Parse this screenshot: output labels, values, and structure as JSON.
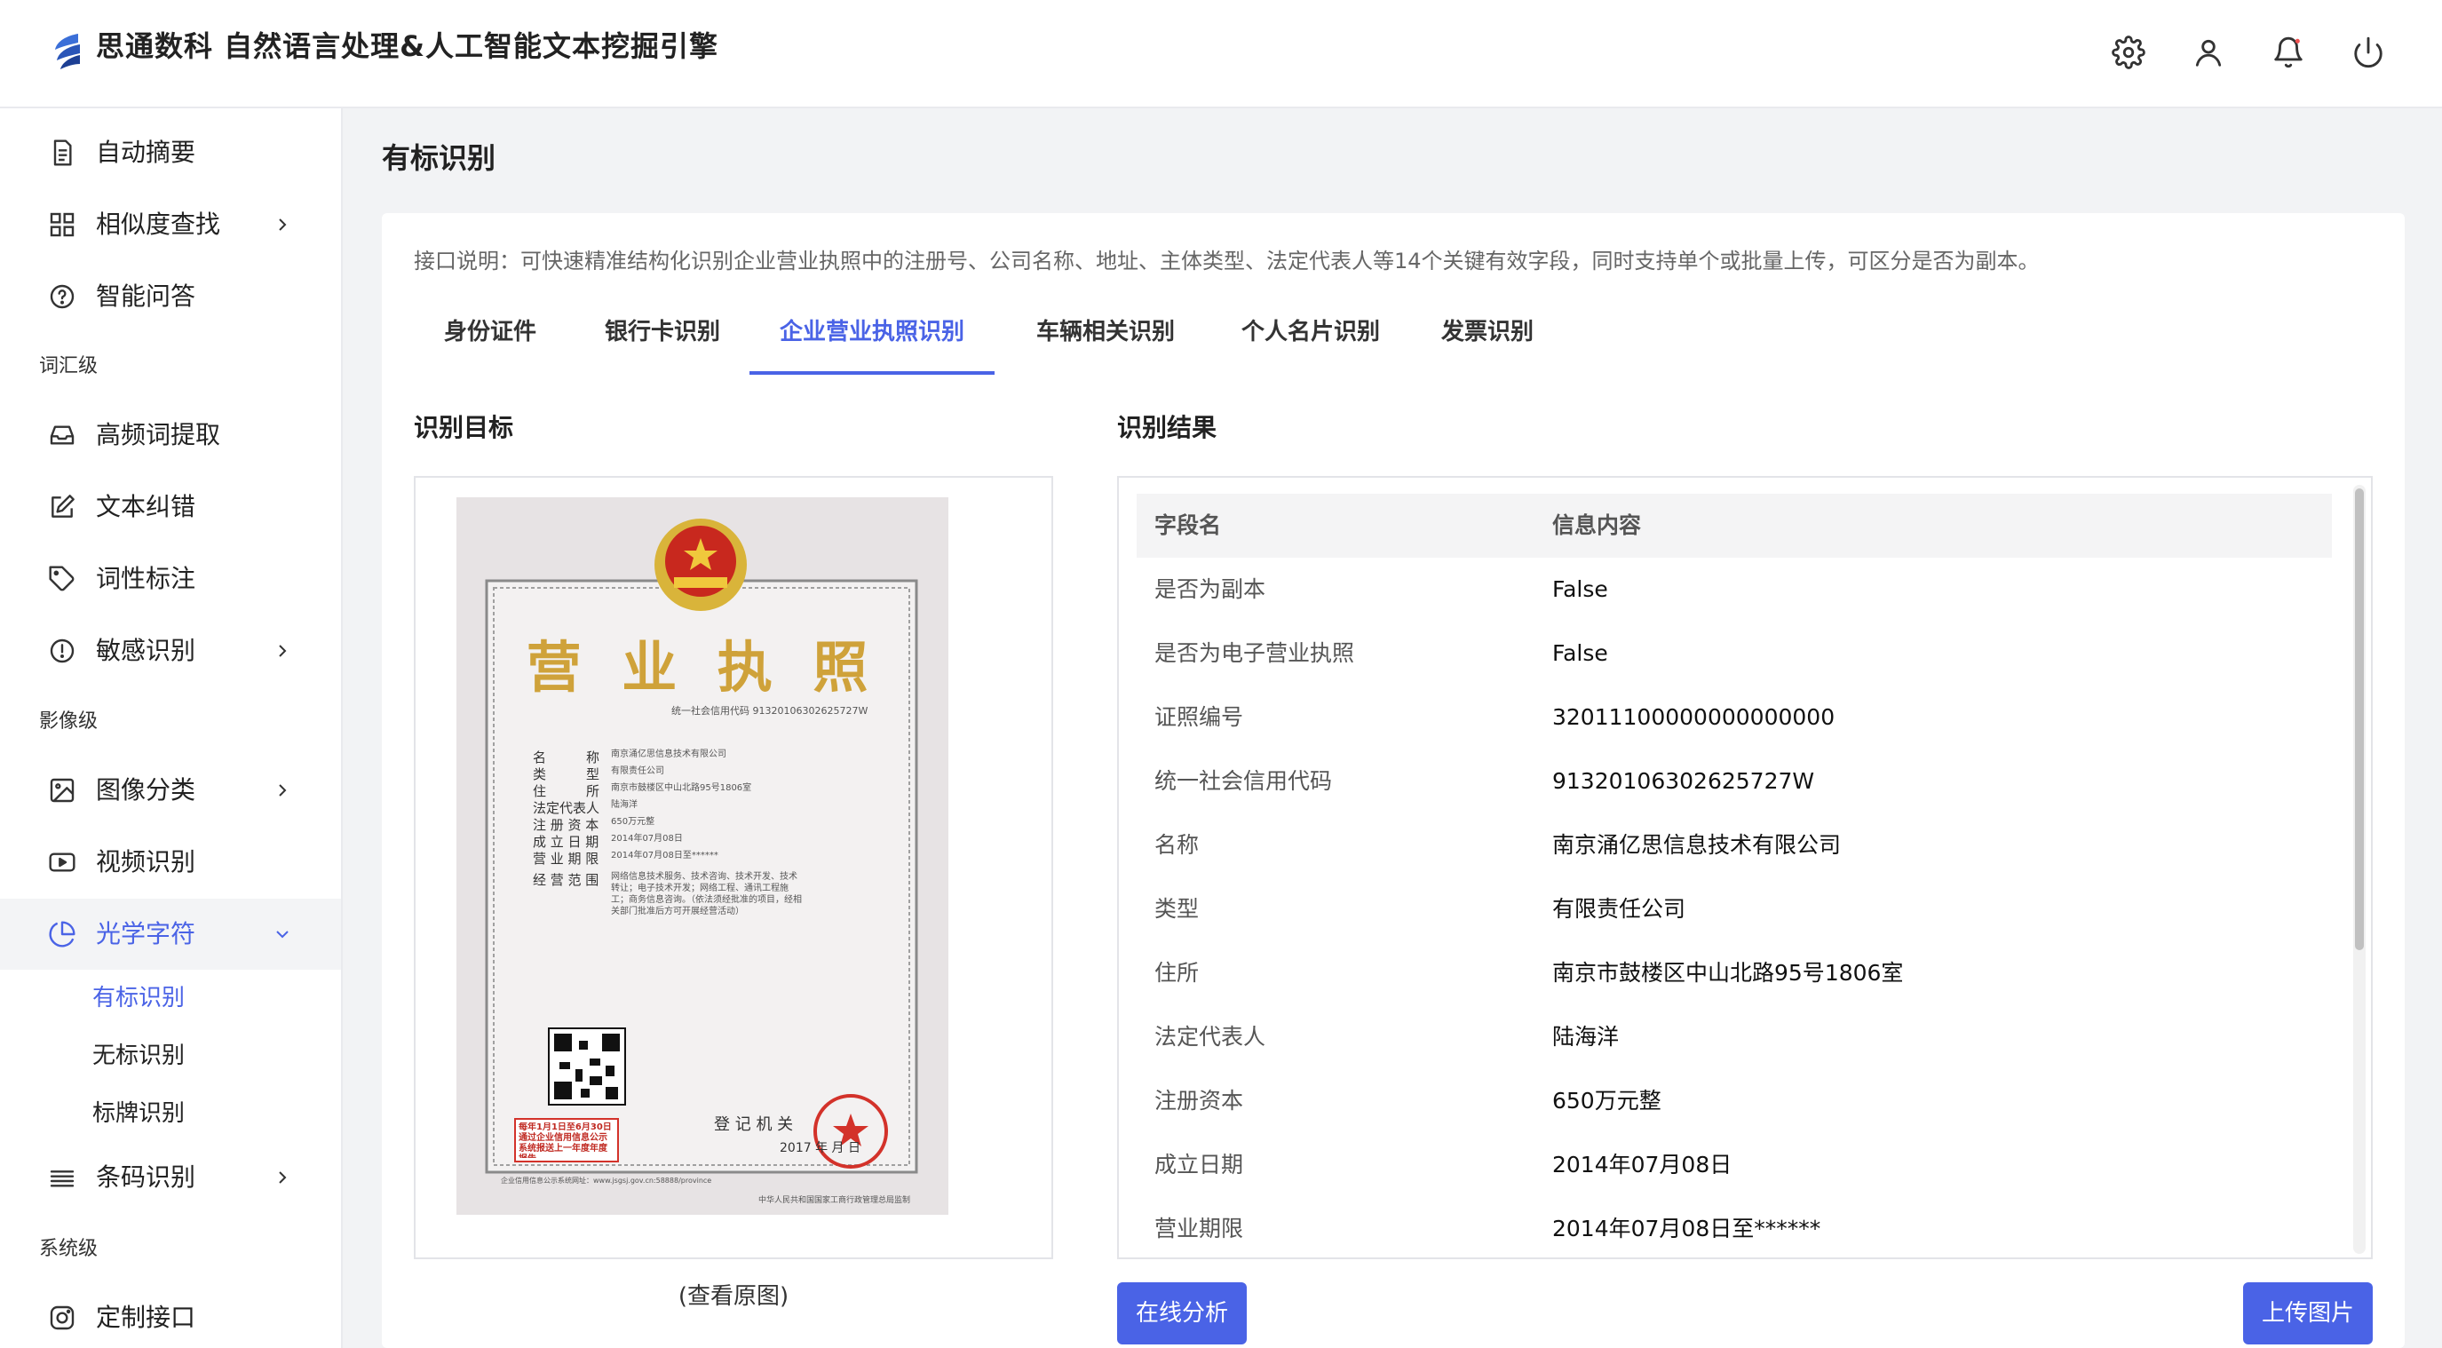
{
  "header": {
    "title": "思通数科 自然语言处理&人工智能文本挖掘引擎",
    "icons": [
      "gear-icon",
      "user-icon",
      "bell-icon",
      "power-icon"
    ]
  },
  "sidebar": {
    "items": [
      {
        "label": "自动摘要",
        "icon": "document-icon"
      },
      {
        "label": "相似度查找",
        "icon": "grid-icon"
      },
      {
        "label": "智能问答",
        "icon": "question-circle-icon"
      },
      {
        "label": "高频词提取",
        "icon": "inbox-icon"
      },
      {
        "label": "文本纠错",
        "icon": "edit-icon"
      },
      {
        "label": "词性标注",
        "icon": "tag-icon"
      },
      {
        "label": "敏感识别",
        "icon": "alert-circle-icon"
      },
      {
        "label": "图像分类",
        "icon": "image-icon"
      },
      {
        "label": "视频识别",
        "icon": "video-icon"
      },
      {
        "label": "光学字符",
        "icon": "pie-chart-icon"
      },
      {
        "label": "条码识别",
        "icon": "menu-lines-icon"
      },
      {
        "label": "定制接口",
        "icon": "instagram-icon"
      }
    ],
    "groups": [
      "词汇级",
      "影像级",
      "系统级"
    ],
    "sub_items": [
      "有标识别",
      "无标识别",
      "标牌识别"
    ]
  },
  "main": {
    "page_title": "有标识别",
    "description": "接口说明：可快速精准结构化识别企业营业执照中的注册号、公司名称、地址、主体类型、法定代表人等14个关键有效字段，同时支持单个或批量上传，可区分是否为副本。",
    "tabs": [
      "身份证件",
      "银行卡识别",
      "企业营业执照识别",
      "车辆相关识别",
      "个人名片识别",
      "发票识别"
    ],
    "active_tab": "企业营业执照识别",
    "target_title": "识别目标",
    "result_title": "识别结果",
    "view_original": "(查看原图)",
    "analyze_button": "在线分析",
    "upload_button": "上传图片"
  },
  "license_image": {
    "heading": "营 业 执 照",
    "credit_line": "统一社会信用代码 91320106302625727W",
    "fields": [
      {
        "k": "名　　　称",
        "v": "南京涌亿思信息技术有限公司"
      },
      {
        "k": "类　　　型",
        "v": "有限责任公司"
      },
      {
        "k": "住　　　所",
        "v": "南京市鼓楼区中山北路95号1806室"
      },
      {
        "k": "法定代表人",
        "v": "陆海洋"
      },
      {
        "k": "注 册 资 本",
        "v": "650万元整"
      },
      {
        "k": "成 立 日 期",
        "v": "2014年07月08日"
      },
      {
        "k": "营 业 期 限",
        "v": "2014年07月08日至******"
      },
      {
        "k": "经 营 范 围",
        "v": "网络信息技术服务、技术咨询、技术开发、技术转让；电子技术开发；网络工程、通讯工程施工；商务信息咨询。（依法须经批准的项目，经相关部门批准后方可开展经营活动）"
      }
    ],
    "registrar": "登 记 机 关",
    "date": "2017 年 月 日",
    "notice": "每年1月1日至6月30日通过企业信用信息公示系统报送上一年度年度报告",
    "footer_left": "企业信用信息公示系统网址：www.jsgsj.gov.cn:58888/province",
    "footer_right": "中华人民共和国国家工商行政管理总局监制"
  },
  "results": {
    "header": {
      "field": "字段名",
      "value": "信息内容"
    },
    "rows": [
      {
        "field": "是否为副本",
        "value": "False"
      },
      {
        "field": "是否为电子营业执照",
        "value": "False"
      },
      {
        "field": "证照编号",
        "value": "32011100000000000000"
      },
      {
        "field": "统一社会信用代码",
        "value": "91320106302625727W"
      },
      {
        "field": "名称",
        "value": "南京涌亿思信息技术有限公司"
      },
      {
        "field": "类型",
        "value": "有限责任公司"
      },
      {
        "field": "住所",
        "value": "南京市鼓楼区中山北路95号1806室"
      },
      {
        "field": "法定代表人",
        "value": "陆海洋"
      },
      {
        "field": "注册资本",
        "value": "650万元整"
      },
      {
        "field": "成立日期",
        "value": "2014年07月08日"
      },
      {
        "field": "营业期限",
        "value": "2014年07月08日至******"
      }
    ]
  },
  "colors": {
    "accent": "#4a63e6",
    "background": "#f2f3f5",
    "panel": "#ffffff"
  }
}
